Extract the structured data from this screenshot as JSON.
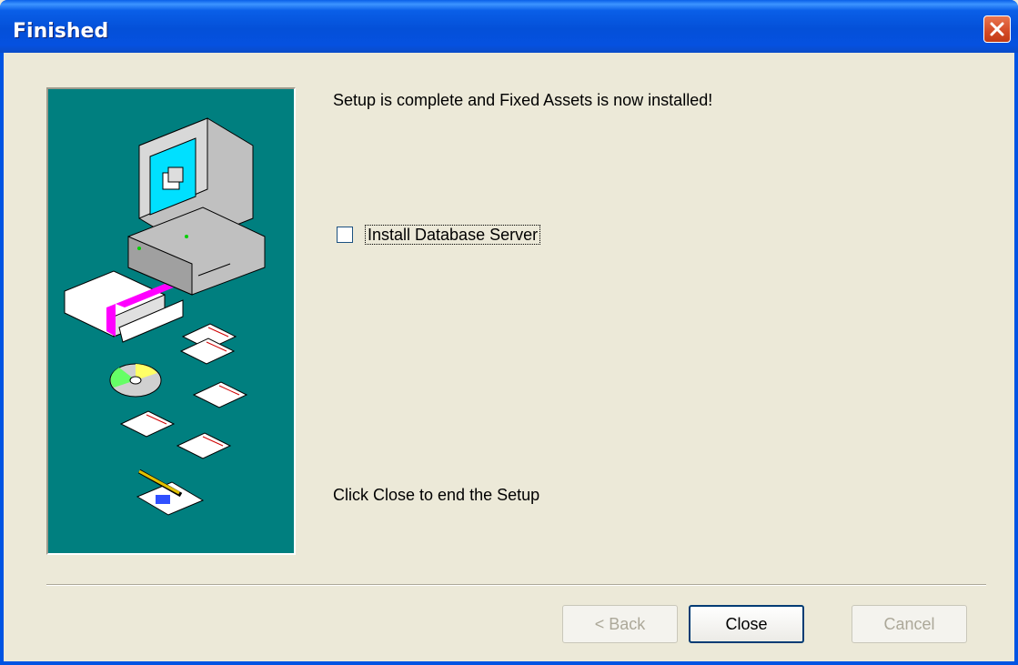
{
  "window": {
    "title": "Finished"
  },
  "content": {
    "headline": "Setup is complete and Fixed Assets is now installed!",
    "checkbox_label": "Install Database Server",
    "checkbox_checked": false,
    "footer_text": "Click Close to end the Setup"
  },
  "buttons": {
    "back_label": "< Back",
    "close_label": "Close",
    "cancel_label": "Cancel"
  },
  "icons": {
    "close": "close-icon",
    "illustration": "setup-illustration"
  },
  "colors": {
    "titlebar": "#0054e3",
    "dialog_bg": "#ece9d8",
    "illustration_bg": "#007f7f",
    "close_button": "#d34a26"
  }
}
